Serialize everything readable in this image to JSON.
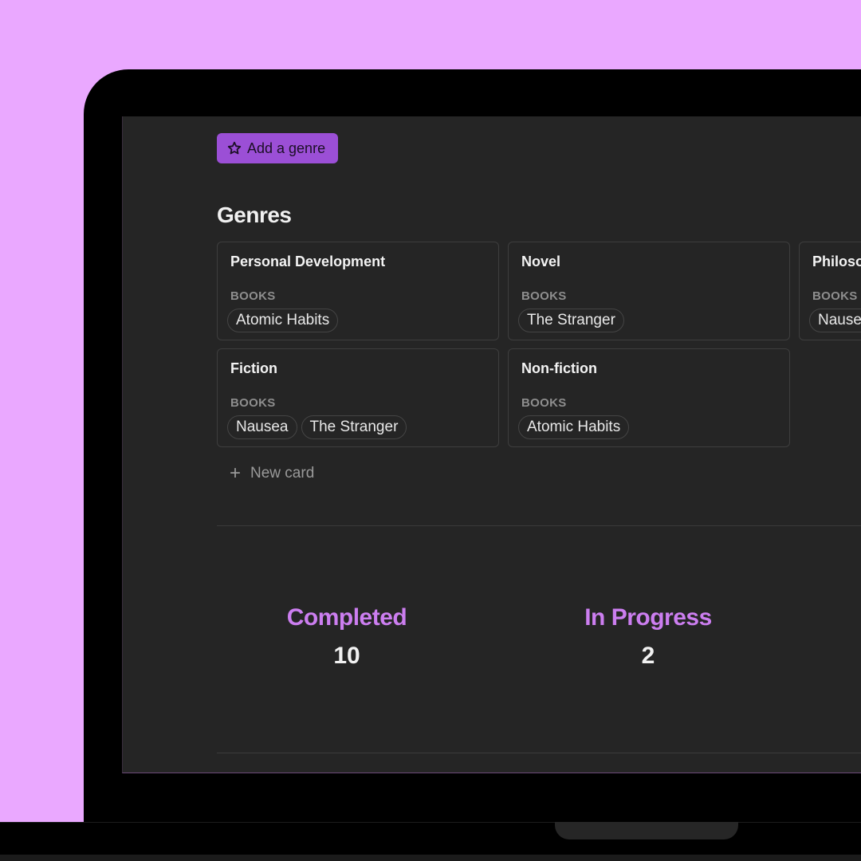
{
  "toolbar": {
    "add_genre_label": "Add a genre",
    "add_genre_icon": "star-icon"
  },
  "section": {
    "title": "Genres"
  },
  "cards": [
    {
      "title": "Personal Development",
      "label": "BOOKS",
      "books": [
        "Atomic Habits"
      ]
    },
    {
      "title": "Novel",
      "label": "BOOKS",
      "books": [
        "The Stranger"
      ]
    },
    {
      "title": "Philosophy",
      "label": "BOOKS",
      "books": [
        "Nausea"
      ]
    },
    {
      "title": "Fiction",
      "label": "BOOKS",
      "books": [
        "Nausea",
        "The Stranger"
      ]
    },
    {
      "title": "Non-fiction",
      "label": "BOOKS",
      "books": [
        "Atomic Habits"
      ]
    }
  ],
  "new_card": {
    "label": "New card",
    "icon": "plus-icon"
  },
  "stats": [
    {
      "label": "Completed",
      "value": "10"
    },
    {
      "label": "In Progress",
      "value": "2"
    }
  ],
  "colors": {
    "background": "#eaa8ff",
    "screen": "#252525",
    "accent_button": "#9b4fd6",
    "stat_label": "#cc7ef0"
  }
}
